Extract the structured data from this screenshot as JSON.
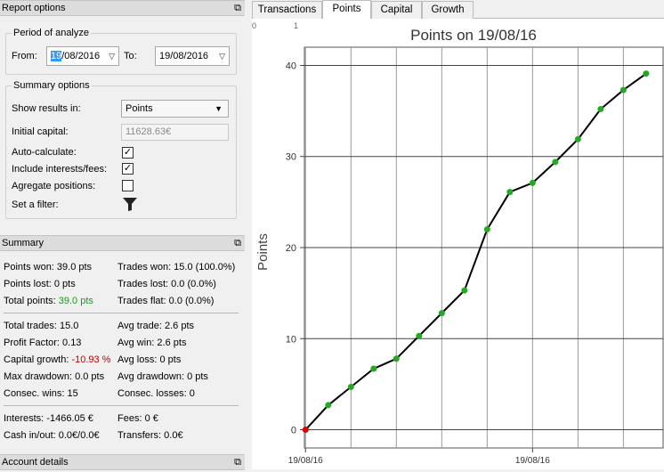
{
  "report_options": {
    "title": "Report options",
    "period": {
      "title": "Period of analyze",
      "from_label": "From:",
      "from_day": "19",
      "from_rest": "/08/2016",
      "to_label": "To:",
      "to_value": "19/08/2016"
    },
    "summary_options": {
      "title": "Summary options",
      "show_results_label": "Show results in:",
      "show_results_value": "Points",
      "initial_capital_label": "Initial capital:",
      "initial_capital_value": "11628.63€",
      "auto_calc_label": "Auto-calculate:",
      "auto_calc_checked": true,
      "include_label": "Include interests/fees:",
      "include_checked": true,
      "aggregate_label": "Agregate positions:",
      "aggregate_checked": false,
      "filter_label": "Set a filter:"
    }
  },
  "summary": {
    "title": "Summary",
    "points_won": "Points won: 39.0 pts",
    "points_lost": "Points lost: 0 pts",
    "total_points_label": "Total points:",
    "total_points_value": "39.0 pts",
    "trades_won": "Trades won: 15.0 (100.0%)",
    "trades_lost": "Trades lost: 0.0 (0.0%)",
    "trades_flat": "Trades flat: 0.0 (0.0%)",
    "total_trades": "Total trades: 15.0",
    "profit_factor": "Profit Factor: 0.13",
    "capital_growth_label": "Capital growth:",
    "capital_growth_value": "-10.93 %",
    "max_drawdown": "Max drawdown: 0.0 pts",
    "consec_wins": "Consec. wins: 15",
    "avg_trade": "Avg trade: 2.6 pts",
    "avg_win": "Avg win: 2.6 pts",
    "avg_loss": "Avg loss: 0 pts",
    "avg_drawdown": "Avg drawdown: 0 pts",
    "consec_losses": "Consec. losses: 0",
    "interests": "Interests: -1466.05 €",
    "cash_inout": "Cash in/out: 0.0€/0.0€",
    "fees": "Fees: 0 €",
    "transfers": "Transfers: 0.0€"
  },
  "account_details": {
    "title": "Account details"
  },
  "dock_icon": "restore-window-icon",
  "tabs": [
    {
      "label": "Transactions",
      "active": false
    },
    {
      "label": "Points",
      "active": true
    },
    {
      "label": "Capital",
      "active": false
    },
    {
      "label": "Growth",
      "active": false
    }
  ],
  "chart_data": {
    "type": "line",
    "title": "Points on 19/08/16",
    "ylabel": "Points",
    "xlabel": "",
    "ylim": [
      -2,
      42
    ],
    "yticks": [
      0,
      10,
      20,
      30,
      40
    ],
    "x_tick_labels": [
      "19/08/16",
      "19/08/16"
    ],
    "top_scale_labels": [
      "0",
      "1"
    ],
    "grid": true,
    "x": [
      0,
      1,
      2,
      3,
      4,
      5,
      6,
      7,
      8,
      9,
      10,
      11,
      12,
      13,
      14,
      15
    ],
    "values": [
      0,
      2.7,
      4.7,
      6.7,
      7.8,
      10.3,
      12.8,
      15.3,
      22.0,
      26.1,
      27.1,
      29.4,
      31.9,
      35.2,
      37.3,
      39.1
    ],
    "point_colors": [
      "#e00000",
      "#22aa22",
      "#22aa22",
      "#22aa22",
      "#22aa22",
      "#22aa22",
      "#22aa22",
      "#22aa22",
      "#22aa22",
      "#22aa22",
      "#22aa22",
      "#22aa22",
      "#22aa22",
      "#22aa22",
      "#22aa22",
      "#22aa22"
    ],
    "line_color": "#000000"
  }
}
